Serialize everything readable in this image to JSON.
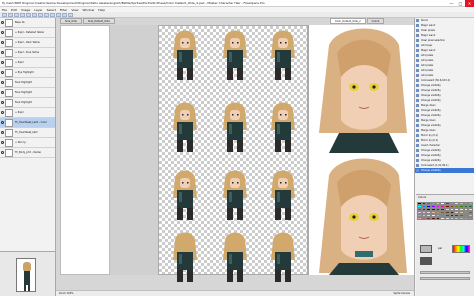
{
  "window": {
    "title": "Ty Cash RPM Original Creator/Game Development/Original Patio Awakening/Art/Battle/Sprites/Portraits Phase/Color Default_Olde_2.psd - Master Character Hair - FireAlpaca Pro",
    "controls": [
      "—",
      "□",
      "✕"
    ]
  },
  "menu": [
    "File",
    "Edit",
    "Image",
    "Layer",
    "Select",
    "Filter",
    "View",
    "Window",
    "Help"
  ],
  "tabs": [
    {
      "label": "Side_Olde",
      "active": false
    },
    {
      "label": "Side_Default_Olde",
      "active": false
    },
    {
      "label": "Color_Default_Olde_2",
      "active": true
    },
    {
      "label": "Color2",
      "active": false
    }
  ],
  "layers": [
    {
      "name": "Base 1b"
    },
    {
      "name": "+ Pupil - Detailed Yellow"
    },
    {
      "name": "+ Pupil - Dark Yellow"
    },
    {
      "name": "+ Pupil - Pure Yellow"
    },
    {
      "name": "+ Pupil"
    },
    {
      "name": "+ Eye Highlight"
    },
    {
      "name": "Face Highlight"
    },
    {
      "name": "Face Highlight"
    },
    {
      "name": "Face Highlight"
    },
    {
      "name": "+ Pupil"
    },
    {
      "name": "Th_Heartbeat_Lab3 - Color"
    },
    {
      "name": "Th_Heartbeat_lab3"
    },
    {
      "name": "+ Skinny"
    },
    {
      "name": "Th_Body_ph3 - Darker"
    }
  ],
  "selected_layer_index": 10,
  "history": [
    "Pencil",
    "Magic wand",
    "Clear pixels",
    "Magic wand",
    "Clear pixel selection",
    "Add layer",
    "Magic wand",
    "Add pixels",
    "Add pixels",
    "Add pixels",
    "Add pixels",
    "Add pixels",
    "Colorselect (50.6,103.4)",
    "Change visibility",
    "Change visibility",
    "Change visibility",
    "Change visibility",
    "Merge down",
    "Change visibility",
    "Change visibility",
    "Merge down",
    "Change visibility",
    "Merge down",
    "Mirror by (0,1)",
    "Mirror by (0,1)",
    "Insert character",
    "Change visibility",
    "Change visibility",
    "Change visibility",
    "Colorselect (1,01,99.1)",
    "Change visibility"
  ],
  "selected_history_index": 30,
  "colors_panel": {
    "title": "Colors",
    "tab": "Change visibility",
    "primary": "#b8b8b8",
    "secondary": "#555555",
    "label": "pal"
  },
  "palette": [
    "#000000",
    "#333333",
    "#666666",
    "#999999",
    "#cccccc",
    "#ffffff",
    "#ff0000",
    "#ff8000",
    "#ffff00",
    "#80ff00",
    "#00ff00",
    "#00ff80",
    "#00ffff",
    "#0080ff",
    "#0000ff",
    "#8000ff",
    "#ff00ff",
    "#ff0080",
    "#800000",
    "#804000",
    "#808000",
    "#408000",
    "#008000",
    "#008040",
    "#008080",
    "#004080",
    "#000080",
    "#400080",
    "#800080",
    "#800040",
    "#ffcccc",
    "#ffe0c0",
    "#ffffcc",
    "#ccffcc",
    "#ccffff",
    "#cce0ff",
    "#e0ccff",
    "#ffccff",
    "#f4d8b8",
    "#e6b98f",
    "#c9925a",
    "#8a5a2e",
    "#5c3a1a",
    "#2d1a0a",
    "#e9dcc4",
    "#d7c08f",
    "#b39359",
    "#7a5f34",
    "#c2a066",
    "#e6d06e",
    "#f5e08a",
    "#fff0b0",
    "#a0c060",
    "#6e9a3a",
    "#3b5c24",
    "#1c2c12",
    "#28455c",
    "#3a6584",
    "#5c8db0",
    "#9cc4e2",
    "#e8a0a0",
    "#c06060",
    "#903030",
    "#601818",
    "#301010",
    "#f0f0f0",
    "#e0e0e0",
    "#d0d0d0",
    "#c0c0c0",
    "#b0b0b0",
    "#a0a0a0",
    "#909090"
  ],
  "status": {
    "left": "Zoom 100%",
    "right": "Sprite Canvas"
  }
}
